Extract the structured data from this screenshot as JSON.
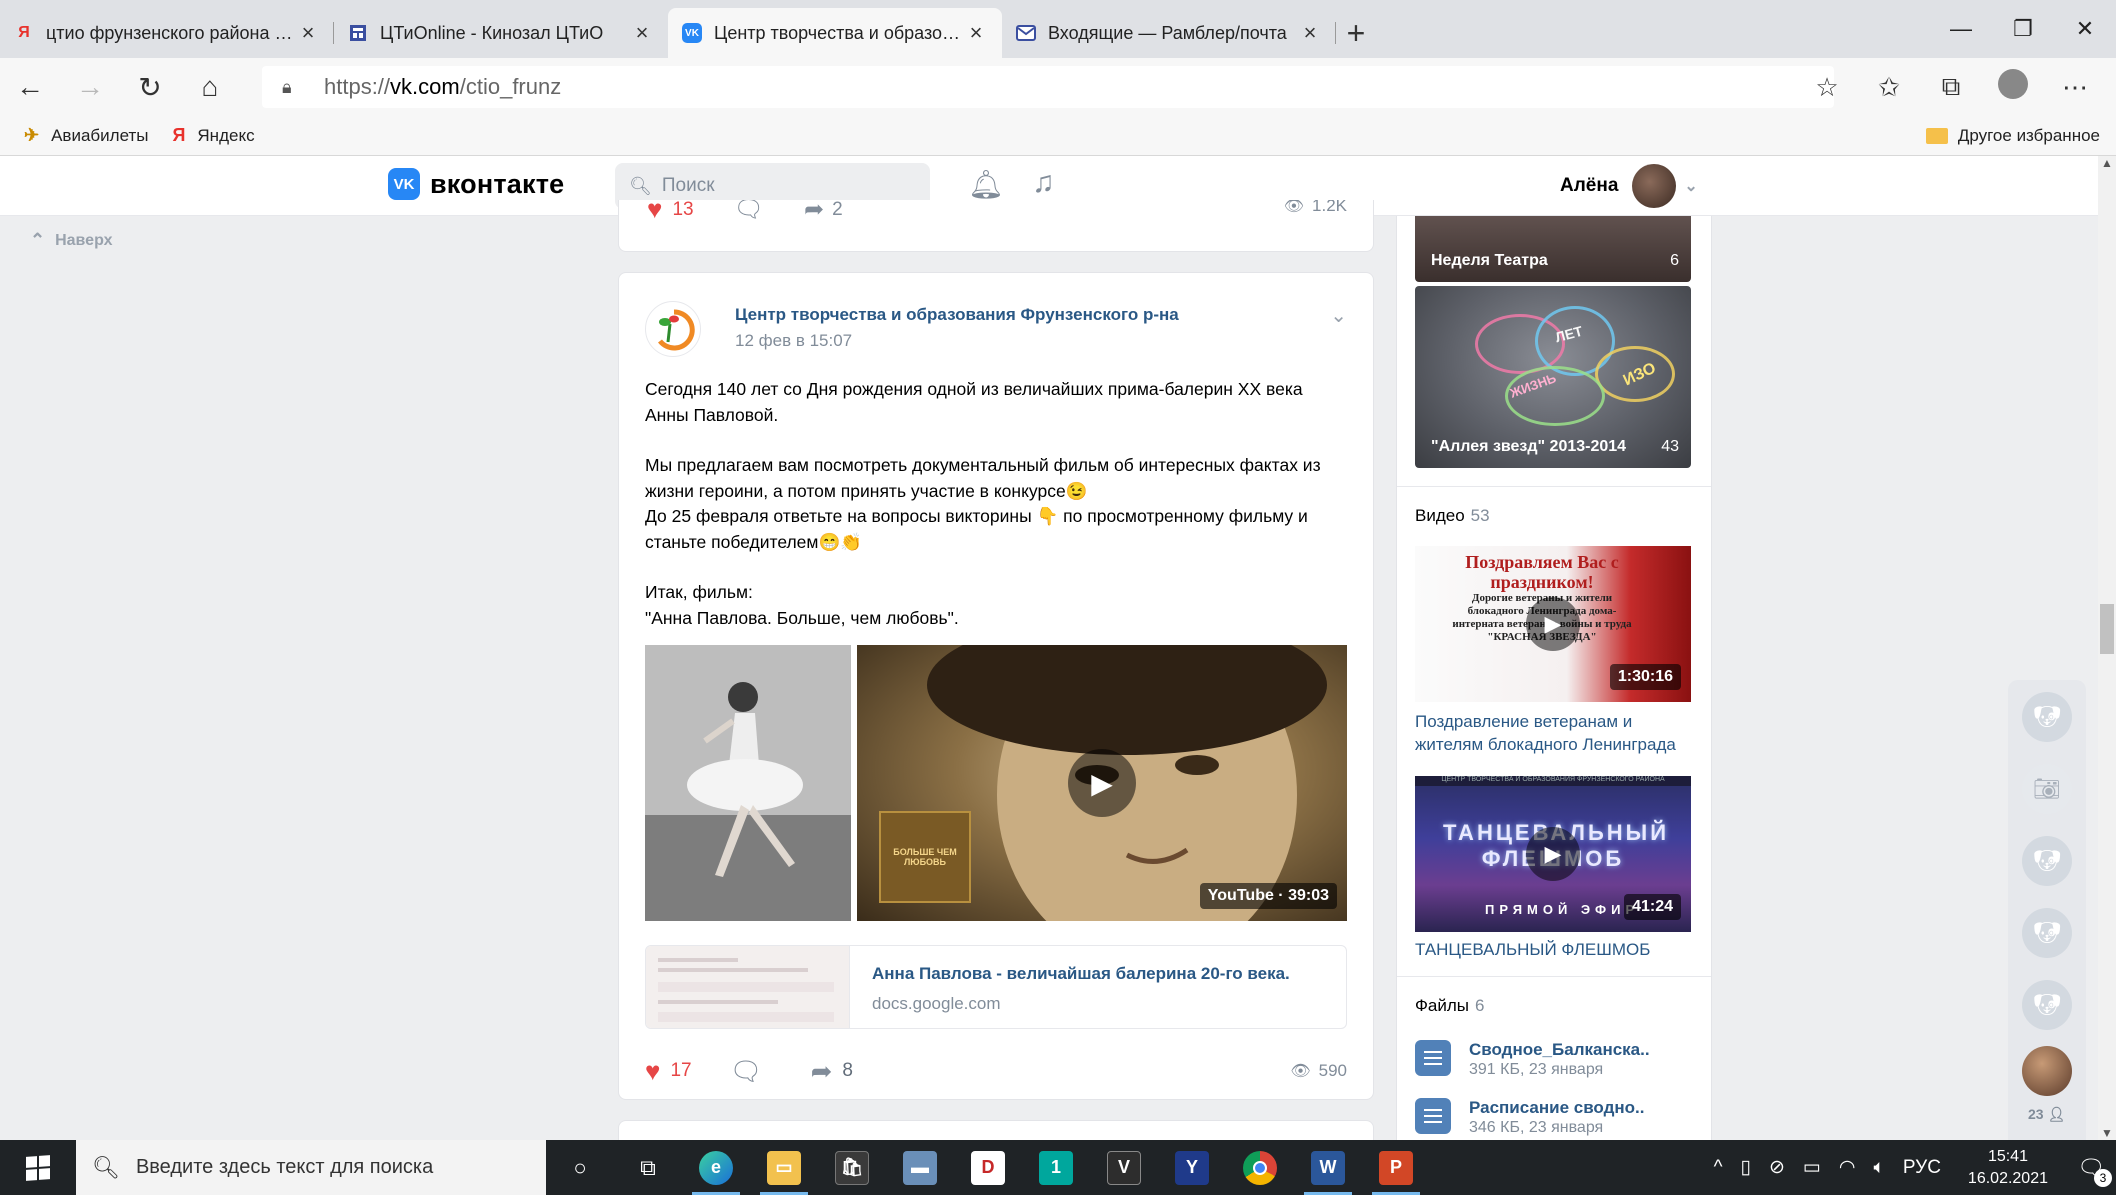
{
  "browser": {
    "tabs": [
      {
        "title": "цтио фрунзенского района оф",
        "icon": "yandex-icon",
        "active": false
      },
      {
        "title": "ЦТиOnline - Кинозал ЦТиО",
        "icon": "page-icon",
        "active": false
      },
      {
        "title": "Центр творчества и образован",
        "icon": "vk-icon",
        "active": true
      },
      {
        "title": "Входящие — Рамблер/почта",
        "icon": "mail-icon",
        "active": false
      }
    ],
    "url_prefix": "https://",
    "url_host": "vk.com",
    "url_path": "/ctio_frunz",
    "bookmarks": [
      {
        "label": "Авиабилеты",
        "icon": "plane-icon"
      },
      {
        "label": "Яндекс",
        "icon": "yandex-icon"
      }
    ],
    "other_bookmarks": "Другое избранное"
  },
  "vk": {
    "logo_text": "вконтакте",
    "logo_mark": "VK",
    "search_placeholder": "Поиск",
    "user_name": "Алёна",
    "to_top": "Наверх"
  },
  "prev_post": {
    "likes": "13",
    "shares": "2",
    "views": "1.2K"
  },
  "post": {
    "author": "Центр творчества и образования Фрунзенского р-на",
    "date": "12 фев в 15:07",
    "text": {
      "p1": "Сегодня 140 лет со Дня рождения одной из величайших прима-балерин XX века Анны Павловой.",
      "p2a": "Мы предлагаем вам посмотреть документальный фильм об интересных фактах из жизни героини, а потом принять участие в конкурсе😉",
      "p2b": "До 25 февраля ответьте на вопросы викторины 👇 по просмотренному фильму и станьте победителем😁👏",
      "p3a": "Итак, фильм:",
      "p3b": "\"Анна Павлова. Больше, чем любовь\"."
    },
    "video_badge": "YouTube · 39:03",
    "poster_text": "БОЛЬШЕ ЧЕМ ЛЮБОВЬ",
    "link_title": "Анна Павлова - величайшая балерина 20-го века.",
    "link_domain": "docs.google.com",
    "likes": "17",
    "shares": "8",
    "views": "590"
  },
  "sidebar": {
    "albums": [
      {
        "title": "Неделя Театра",
        "count": "6"
      },
      {
        "title": "\"Аллея звезд\" 2013-2014",
        "count": "43"
      }
    ],
    "chalk_words": [
      "ЛЕТ",
      "ИЗО",
      "ЖИЗНЬ"
    ],
    "videos_title": "Видео",
    "videos_count": "53",
    "videos": [
      {
        "duration": "1:30:16",
        "title": "Поздравление ветеранам и жителям блокадного Ленинграда",
        "thumb_heading": "Поздравляем Вас с праздником!",
        "thumb_text": "Дорогие ветераны и жители блокадного Ленинграда дома-интерната ветеранов войны и труда \"КРАСНАЯ ЗВЕЗДА\""
      },
      {
        "duration": "41:24",
        "title": "ТАНЦЕВАЛЬНЫЙ ФЛЕШМОБ",
        "thumb_heading": "ТАНЦЕВАЛЬНЫЙ ФЛЕШМОБ",
        "thumb_sub": "ПРЯМОЙ ЭФИР",
        "thumb_strip": "ЦЕНТР ТВОРЧЕСТВА И ОБРАЗОВАНИЯ ФРУНЗЕНСКОГО РАЙОНА"
      }
    ],
    "files_title": "Файлы",
    "files_count": "6",
    "files": [
      {
        "name": "Сводное_Балканска..",
        "meta": "391 КБ, 23 января"
      },
      {
        "name": "Расписание сводно..",
        "meta": "346 КБ, 23 января"
      }
    ]
  },
  "friends_bar": {
    "online_count": "23"
  },
  "taskbar": {
    "search_placeholder": "Введите здесь текст для поиска",
    "lang": "РУС",
    "time": "15:41",
    "date": "16.02.2021",
    "notifications": "3"
  },
  "colors": {
    "vk_blue": "#2787f5",
    "link": "#2a5885",
    "like_red": "#e64646",
    "muted": "#818c99"
  }
}
